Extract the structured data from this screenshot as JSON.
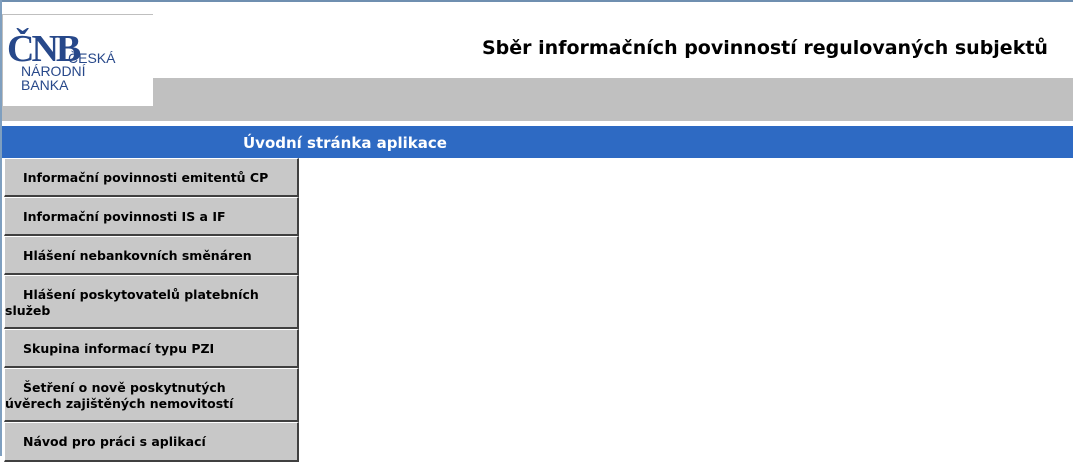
{
  "logo": {
    "mark": "ČNB",
    "line1": "ČESKÁ",
    "line2": "NÁRODNÍ",
    "line3": "BANKA"
  },
  "header": {
    "title": "Sběr informačních povinností regulovaných subjektů"
  },
  "nav_bar": {
    "title": "Úvodní stránka aplikace"
  },
  "menu": {
    "items": [
      {
        "label": "Informační povinnosti emitentů CP"
      },
      {
        "label": "Informační povinnosti IS a IF"
      },
      {
        "label": "Hlášení nebankovních směnáren"
      },
      {
        "label_line1": "Hlášení poskytovatelů platebních",
        "label_line2": "služeb"
      },
      {
        "label": "Skupina informací typu PZI"
      },
      {
        "label_line1": "Šetření o nově poskytnutých",
        "label_line2": "úvěrech zajištěných nemovitostí"
      },
      {
        "label": "Návod pro práci s aplikací"
      }
    ]
  },
  "colors": {
    "nav_bar_blue": "#2e6ac3",
    "header_gray": "#c0c0c0",
    "menu_gray": "#c8c8c8",
    "logo_blue": "#27488a"
  }
}
